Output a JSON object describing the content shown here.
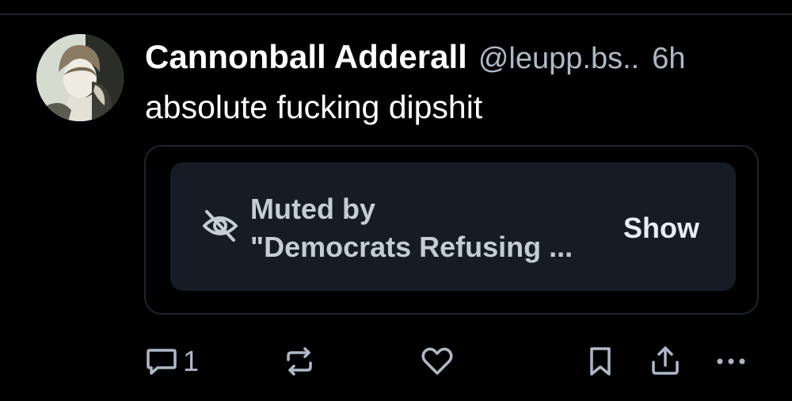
{
  "post": {
    "author": {
      "display_name": "Cannonball Adderall",
      "handle": "@leupp.bs..",
      "timestamp": "6h"
    },
    "text": "absolute fucking dipshit",
    "embed": {
      "muted_line1": "Muted by",
      "muted_line2": "\"Democrats Refusing ...",
      "show_label": "Show",
      "icon": "eye-off-icon"
    },
    "actions": {
      "reply_count": "1",
      "icons": [
        "reply-icon",
        "repost-icon",
        "like-icon",
        "bookmark-icon",
        "share-icon",
        "more-icon"
      ]
    }
  },
  "colors": {
    "background": "#000000",
    "primary_text": "#ffffff",
    "secondary_text": "#aeb9c7",
    "muted_card_bg": "#161c25",
    "border": "#1e242d"
  }
}
